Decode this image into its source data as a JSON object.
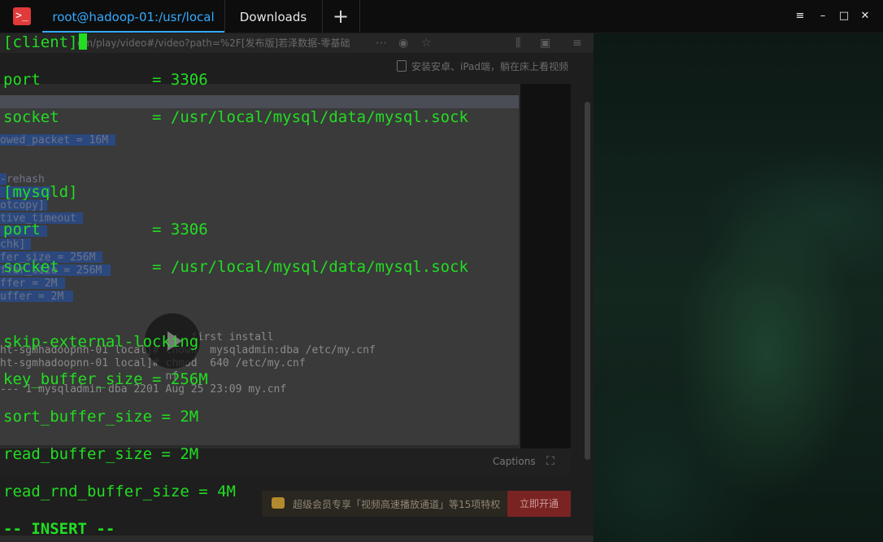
{
  "titlebar": {
    "tabs": [
      {
        "label": "root@hadoop-01:/usr/local",
        "active": true
      },
      {
        "label": "Downloads",
        "active": false
      }
    ],
    "add_tab_glyph": "+",
    "window_buttons": {
      "menu": "≡",
      "minimize": "–",
      "maximize": "□",
      "close": "✕"
    }
  },
  "terminal": {
    "lines": [
      "[client]",
      "port            = 3306",
      "socket          = /usr/local/mysql/data/mysql.sock",
      "[mysqld]",
      "port            = 3306",
      "socket          = /usr/local/mysql/data/mysql.sock",
      "skip-external-locking",
      "key_buffer_size = 256M",
      "sort_buffer_size = 2M",
      "read_buffer_size = 2M",
      "read_rnd_buffer_size = 4M",
      "-- INSERT --"
    ]
  },
  "background_browser": {
    "url_fragment": "om/play/video#/video?path=%2F[发布版]若泽数据-零基础",
    "hint_text": "安装安卓、iPad端，躺在床上看视频",
    "video_text": [
      "owed_packet = 16M",
      "-rehash",
      "otcopy]",
      "tive_timeout",
      "chk]",
      "fer_size = 256M",
      "ffer_size = 256M",
      "ffer = 2M",
      "uffer = 2M",
      "                              first install",
      "ht-sgmhadoopnn-01 local]# chown  mysqladmin:dba /etc/my.cnf",
      "ht-sgmhadoopnn-01 local]# chmod  640 /etc/my.cnf",
      "                          nf",
      "--- 1 mysqladmin dba 2201 Aug 25 23:09 my.cnf"
    ],
    "captions_label": "Captions",
    "vip_text": "超级会员专享「视频高速播放通道」等15项特权",
    "vip_button": "立即开通"
  },
  "colors": {
    "terminal_text": "#22dd22",
    "active_tab": "#33aaff"
  }
}
